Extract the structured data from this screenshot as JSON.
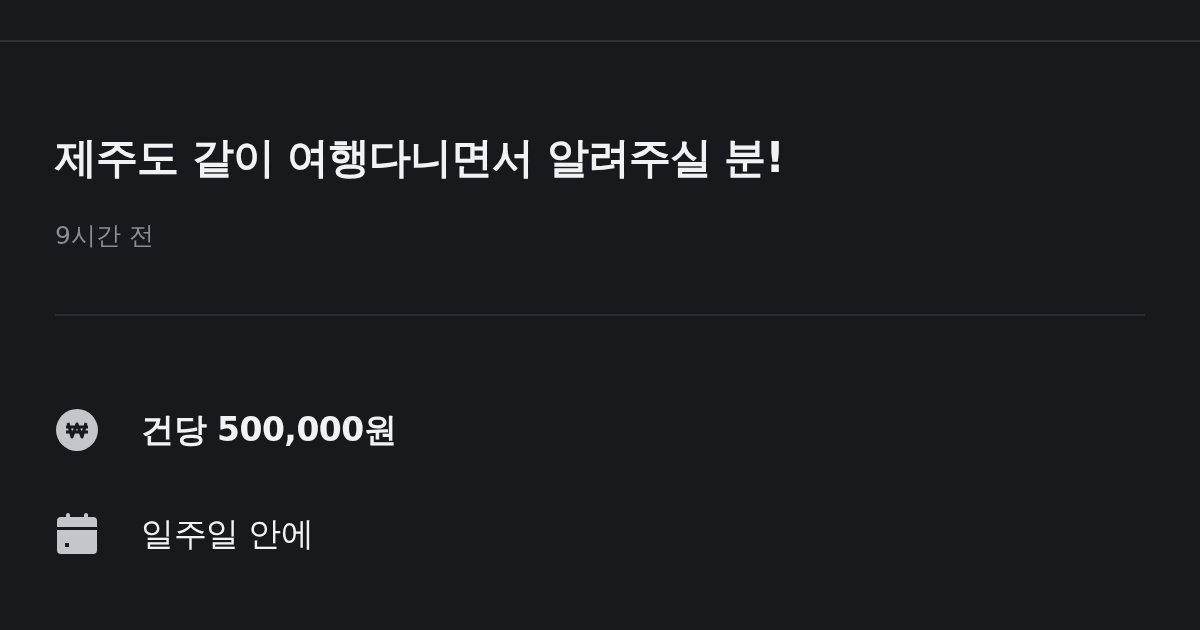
{
  "post": {
    "title": "제주도 같이 여행다니면서 알려주실 분!",
    "time": "9시간 전"
  },
  "details": [
    {
      "kind": "price",
      "text": "건당 500,000원"
    },
    {
      "kind": "deadline",
      "text": "일주일 안에"
    }
  ]
}
